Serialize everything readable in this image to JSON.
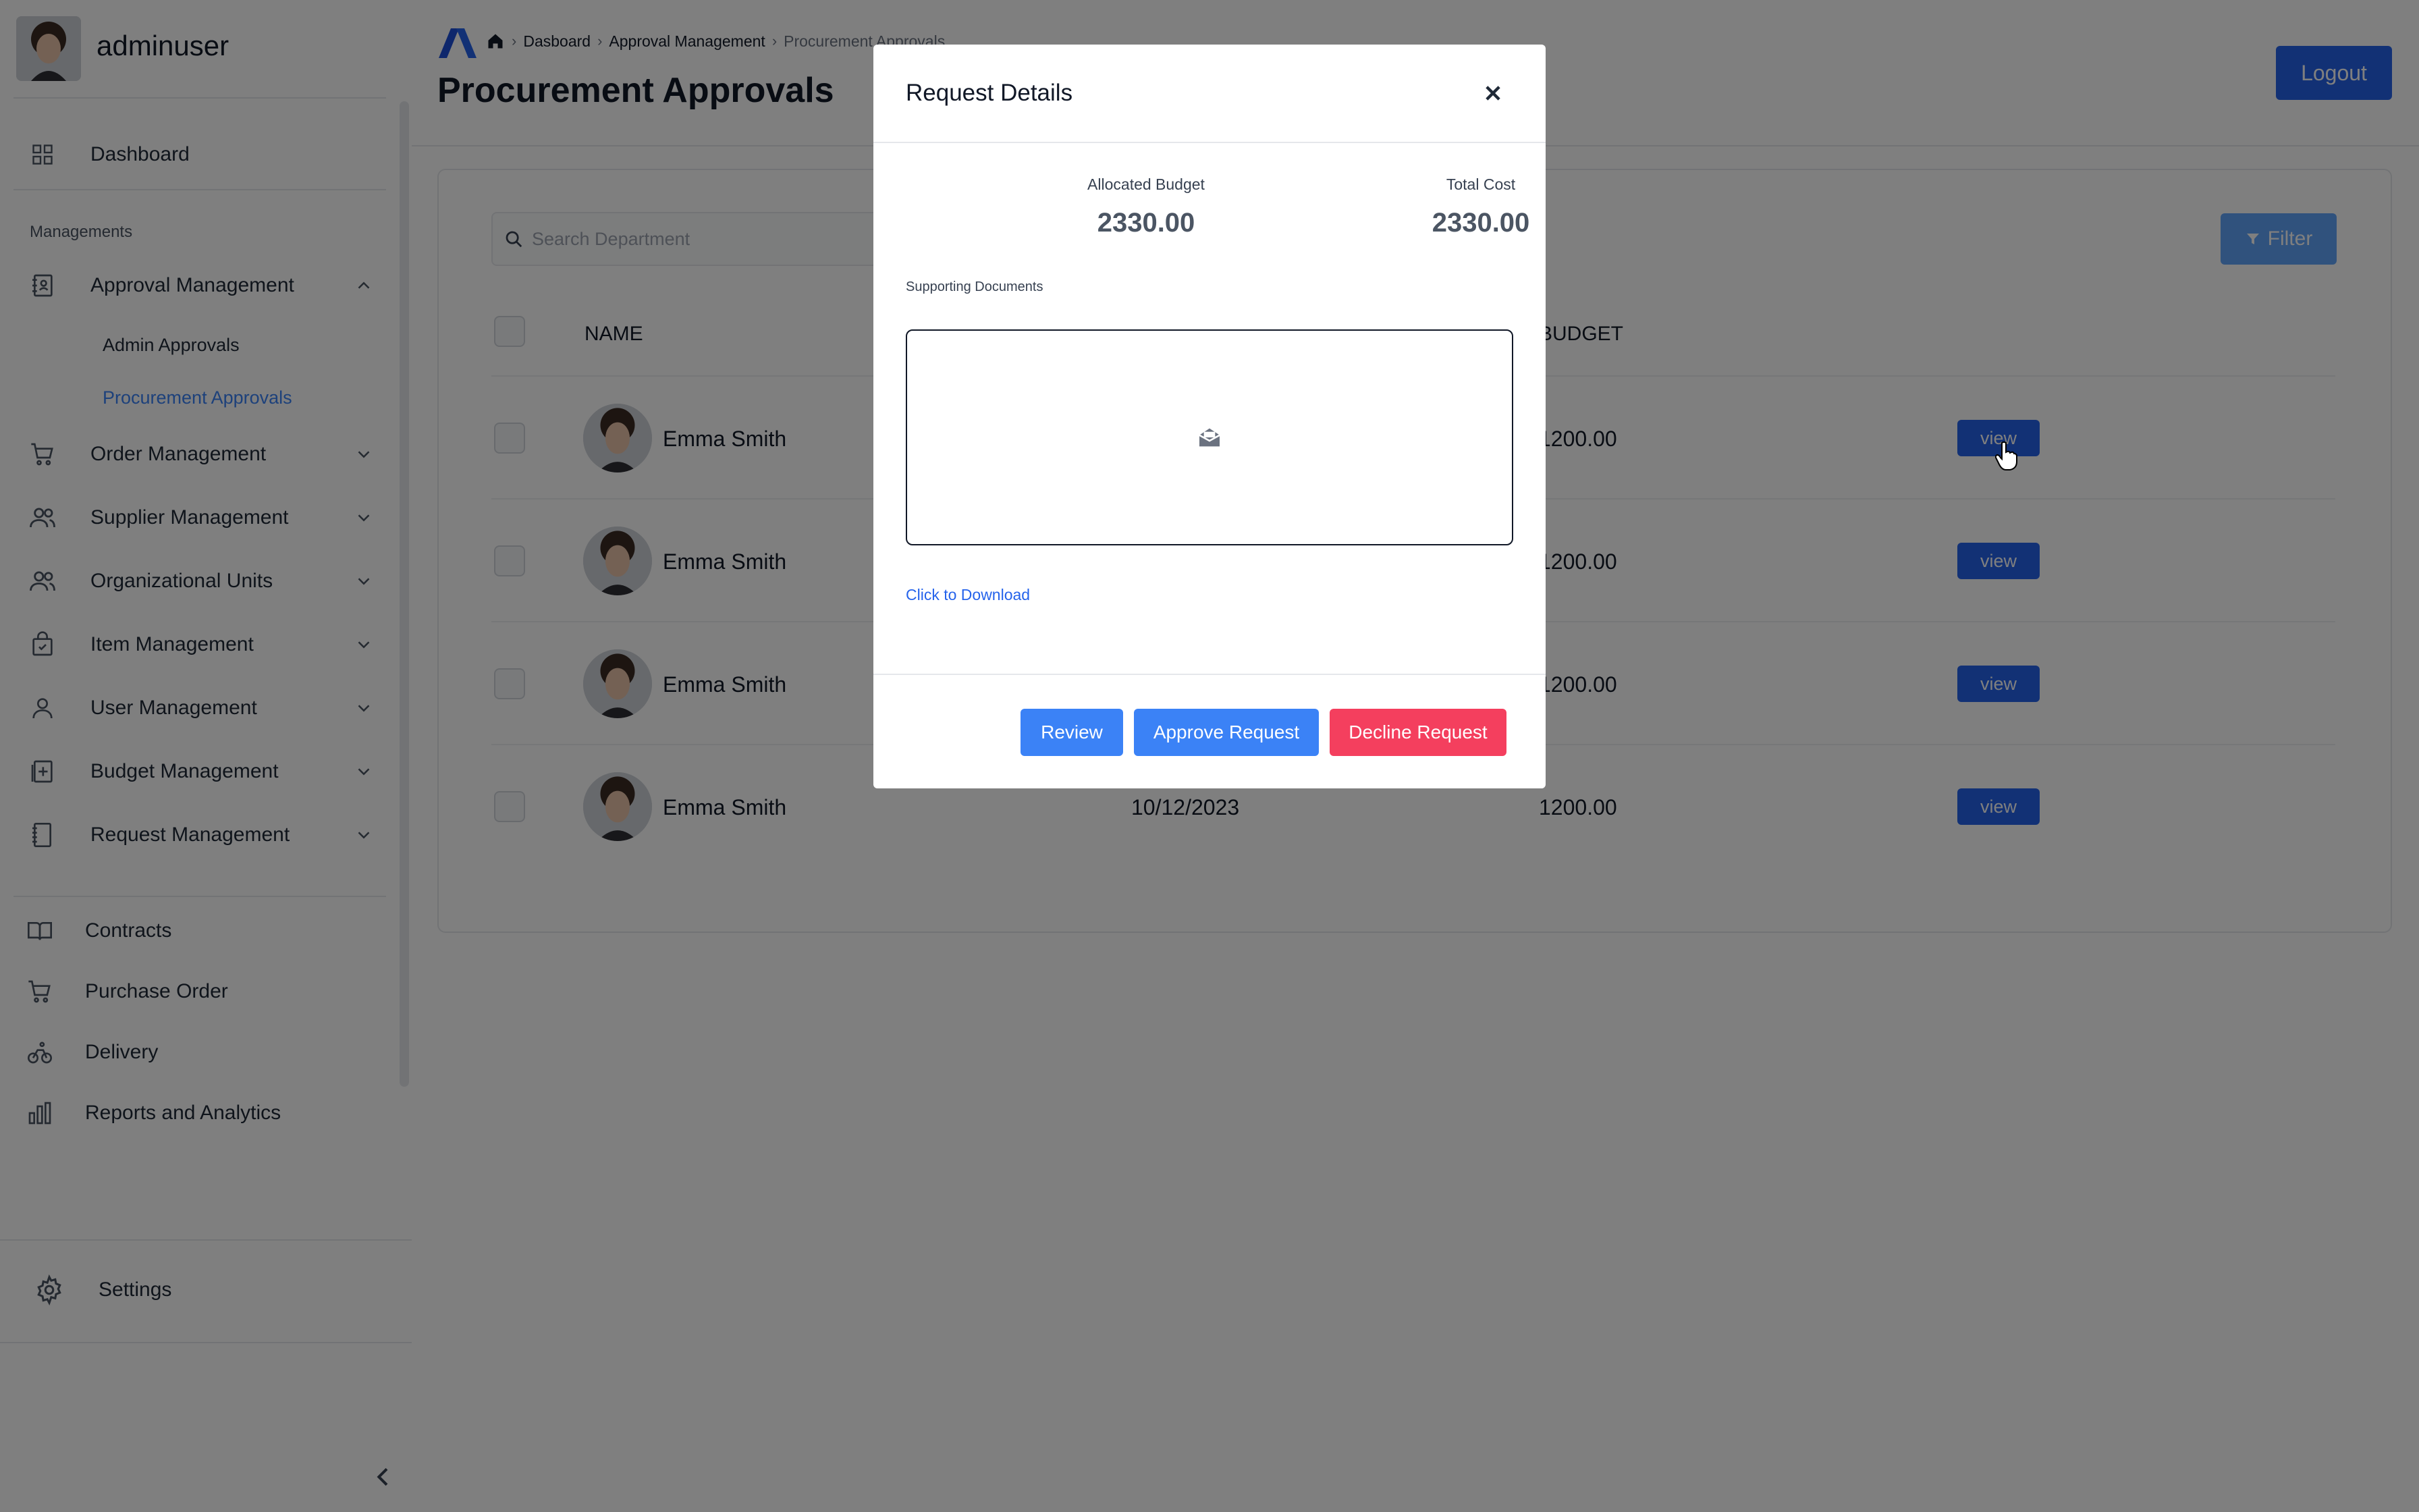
{
  "sidebar": {
    "username": "adminuser",
    "dashboard": "Dashboard",
    "section_title": "Managements",
    "approval_management": "Approval Management",
    "admin_approvals": "Admin Approvals",
    "procurement_approvals": "Procurement Approvals",
    "order_management": "Order Management",
    "supplier_management": "Supplier Management",
    "organizational_units": "Organizational Units",
    "item_management": "Item Management",
    "user_management": "User Management",
    "budget_management": "Budget Management",
    "request_management": "Request Management",
    "contracts": "Contracts",
    "purchase_order": "Purchase Order",
    "delivery": "Delivery",
    "reports_analytics": "Reports and Analytics",
    "settings": "Settings"
  },
  "header": {
    "breadcrumb": [
      "Dasboard",
      "Approval Management",
      "Procurement Approvals"
    ],
    "title": "Procurement Approvals",
    "logout": "Logout"
  },
  "table": {
    "search_placeholder": "Search Department",
    "filter_label": "Filter",
    "columns": {
      "name": "NAME",
      "budget": "BUDGET"
    },
    "rows": [
      {
        "name": "Emma Smith",
        "date": "",
        "budget": "1200.00",
        "action": "view"
      },
      {
        "name": "Emma Smith",
        "date": "",
        "budget": "1200.00",
        "action": "view"
      },
      {
        "name": "Emma Smith",
        "date": "",
        "budget": "1200.00",
        "action": "view"
      },
      {
        "name": "Emma Smith",
        "date": "10/12/2023",
        "budget": "1200.00",
        "action": "view"
      }
    ]
  },
  "modal": {
    "title": "Request Details",
    "allocated_budget_label": "Allocated Budget",
    "allocated_budget": "2330.00",
    "total_cost_label": "Total Cost",
    "total_cost": "2330.00",
    "supporting_docs_label": "Supporting Documents",
    "download_link": "Click to Download",
    "review": "Review",
    "approve": "Approve Request",
    "decline": "Decline Request"
  },
  "colors": {
    "primary": "#2563eb",
    "review_blue": "#3b82f6",
    "decline": "#f43f5e",
    "active_link": "#3b82f6"
  }
}
